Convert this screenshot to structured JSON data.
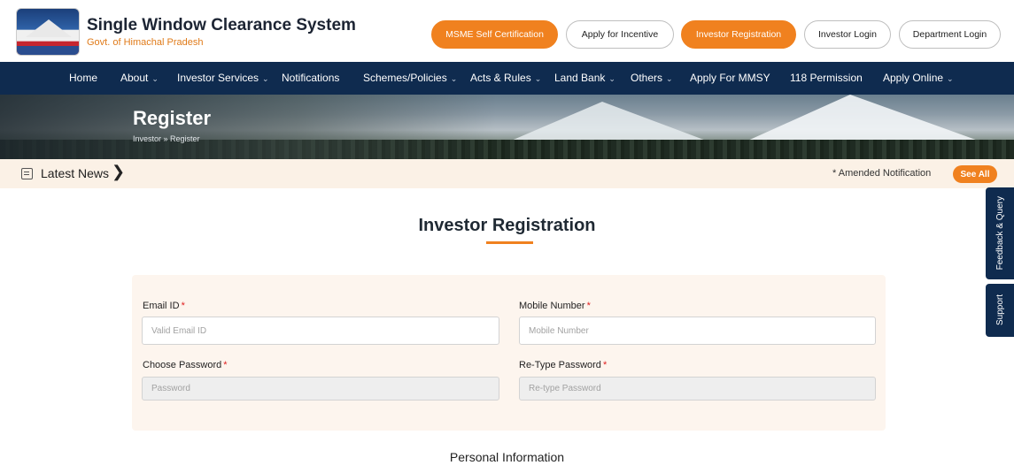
{
  "header": {
    "title": "Single Window Clearance System",
    "subtitle": "Govt. of Himachal Pradesh",
    "buttons": [
      {
        "label": "MSME Self Certification",
        "style": "orange"
      },
      {
        "label": "Apply for Incentive",
        "style": "outline"
      },
      {
        "label": "Investor Registration",
        "style": "orange"
      },
      {
        "label": "Investor Login",
        "style": "outline"
      },
      {
        "label": "Department Login",
        "style": "outline"
      }
    ]
  },
  "nav": {
    "items": [
      {
        "label": "Home",
        "dropdown": false
      },
      {
        "label": "About",
        "dropdown": true
      },
      {
        "label": "Investor Services",
        "dropdown": true
      },
      {
        "label": "Notifications",
        "dropdown": false
      },
      {
        "label": "Schemes/Policies",
        "dropdown": true
      },
      {
        "label": "Acts & Rules",
        "dropdown": true
      },
      {
        "label": "Land Bank",
        "dropdown": true
      },
      {
        "label": "Others",
        "dropdown": true
      },
      {
        "label": "Apply For MMSY",
        "dropdown": false
      },
      {
        "label": "118 Permission",
        "dropdown": false
      },
      {
        "label": "Apply Online",
        "dropdown": true
      }
    ]
  },
  "banner": {
    "title": "Register",
    "breadcrumb": "Investor » Register"
  },
  "news": {
    "label": "Latest News",
    "item": "* Amended Notification",
    "see_all": "See All"
  },
  "side_tabs": {
    "feedback": "Feedback & Query",
    "support": "Support"
  },
  "form": {
    "title": "Investor Registration",
    "email_label": "Email ID",
    "email_placeholder": "Valid Email ID",
    "mobile_label": "Mobile Number",
    "mobile_placeholder": "Mobile Number",
    "password_label": "Choose Password",
    "password_placeholder": "Password",
    "retype_label": "Re-Type Password",
    "retype_placeholder": "Re-type Password",
    "required_mark": "*",
    "personal_heading": "Personal Information"
  },
  "colors": {
    "accent": "#f0811f",
    "navy": "#0f2b4f",
    "card_bg": "#fdf5ee",
    "news_bg": "#fbf1e6",
    "required": "#e02020"
  }
}
